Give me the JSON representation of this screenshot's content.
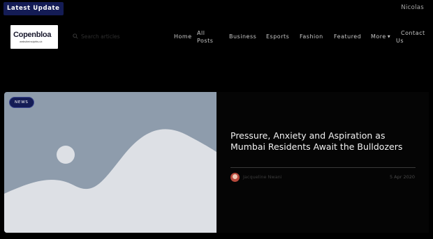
{
  "topbar": {
    "latest_label": "Latest Update",
    "username": "Nicolas"
  },
  "logo": {
    "name": "Copenbloa",
    "tagline": "websiteinsights.uk"
  },
  "search": {
    "placeholder": "Search articles"
  },
  "nav": {
    "items": [
      {
        "label": "Home"
      },
      {
        "label": "All Posts"
      },
      {
        "label": "Business"
      },
      {
        "label": "Esports"
      },
      {
        "label": "Fashion"
      },
      {
        "label": "Featured"
      },
      {
        "label": "More"
      },
      {
        "label": "Contact Us"
      }
    ]
  },
  "featured": {
    "badge": "NEWS",
    "title": "Pressure, Anxiety and Aspiration as Mumbai Residents Await the Bulldozers",
    "author": "Jacqueline Nwani",
    "date": "5 Apr 2020"
  },
  "colors": {
    "background": "#000000",
    "accent": "#141c55",
    "placeholder_bg": "#8e9cac",
    "placeholder_shape": "#dde0e5"
  }
}
